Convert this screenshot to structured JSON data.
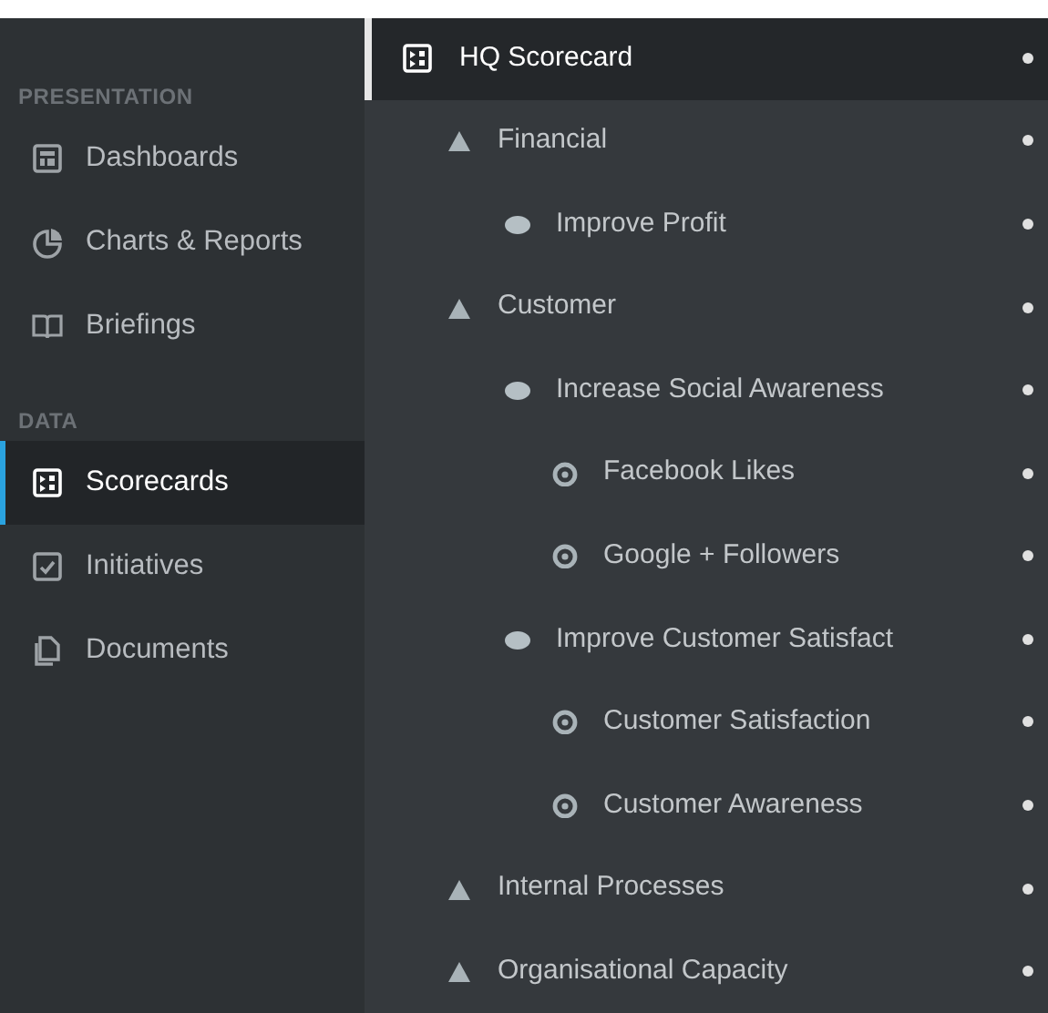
{
  "sidebar": {
    "sections": [
      {
        "heading": "PRESENTATION",
        "items": [
          {
            "label": "Dashboards",
            "kind": "dashboard",
            "selected": false
          },
          {
            "label": "Charts & Reports",
            "kind": "chart",
            "selected": false
          },
          {
            "label": "Briefings",
            "kind": "book",
            "selected": false
          }
        ]
      },
      {
        "heading": "DATA",
        "items": [
          {
            "label": "Scorecards",
            "kind": "scorecard",
            "selected": true
          },
          {
            "label": "Initiatives",
            "kind": "check",
            "selected": false
          },
          {
            "label": "Documents",
            "kind": "documents",
            "selected": false
          }
        ]
      }
    ]
  },
  "scorecard": {
    "title": "HQ Scorecard",
    "children": [
      {
        "kind": "perspective",
        "label": "Financial",
        "children": [
          {
            "kind": "objective",
            "label": "Improve Profit"
          }
        ]
      },
      {
        "kind": "perspective",
        "label": "Customer",
        "children": [
          {
            "kind": "objective",
            "label": "Increase Social Awareness",
            "children": [
              {
                "kind": "measure",
                "label": "Facebook Likes"
              },
              {
                "kind": "measure",
                "label": "Google + Followers"
              }
            ]
          },
          {
            "kind": "objective",
            "label": "Improve Customer Satisfact",
            "children": [
              {
                "kind": "measure",
                "label": "Customer Satisfaction"
              },
              {
                "kind": "measure",
                "label": "Customer Awareness"
              }
            ]
          }
        ]
      },
      {
        "kind": "perspective",
        "label": "Internal Processes"
      },
      {
        "kind": "perspective",
        "label": "Organisational Capacity"
      }
    ]
  }
}
